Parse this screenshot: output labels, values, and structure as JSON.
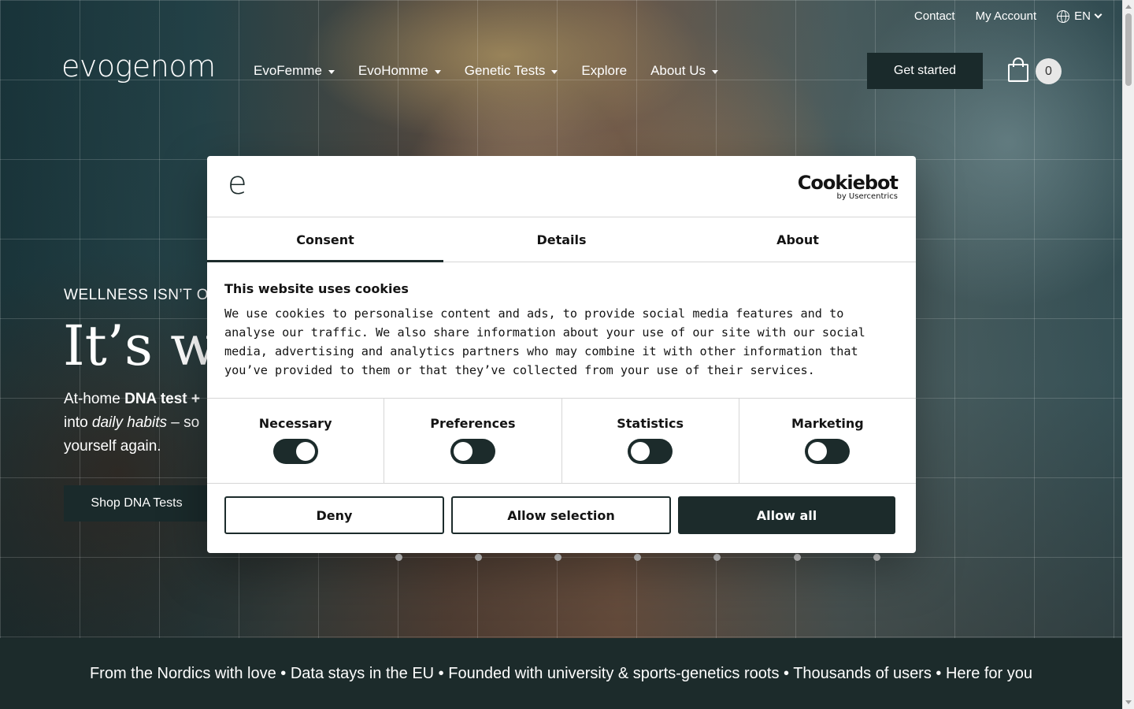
{
  "header": {
    "utility": {
      "contact": "Contact",
      "account": "My Account",
      "language": "EN"
    },
    "logo": "evogenom",
    "nav": [
      "EvoFemme",
      "EvoHomme",
      "Genetic Tests",
      "Explore",
      "About Us"
    ],
    "cta": "Get started",
    "cart_count": "0"
  },
  "hero": {
    "eyebrow": "WELLNESS ISN’T O",
    "headline": "It’s wri",
    "lead": {
      "part1": "At-home ",
      "bold": "DNA test +",
      "line2a": "into ",
      "italic": "daily habits",
      "line2b": " – so",
      "line3": "yourself again."
    },
    "shop_button": "Shop DNA Tests"
  },
  "band_text": "From the Nordics with love • Data stays in the EU • Founded with university & sports-genetics roots • Thousands of users • Here for you",
  "dialog": {
    "logo": "e",
    "brand": "Cookiebot",
    "brand_sub": "by Usercentrics",
    "tabs": [
      "Consent",
      "Details",
      "About"
    ],
    "title": "This website uses cookies",
    "body": "We use cookies to personalise content and ads, to provide social media features and to analyse our traffic. We also share information about your use of our site with our social media, advertising and analytics partners who may combine it with other information that you’ve provided to them or that they’ve collected from your use of their services.",
    "toggles": [
      {
        "label": "Necessary",
        "state": "on"
      },
      {
        "label": "Preferences",
        "state": "off"
      },
      {
        "label": "Statistics",
        "state": "off"
      },
      {
        "label": "Marketing",
        "state": "off"
      }
    ],
    "buttons": {
      "deny": "Deny",
      "selection": "Allow selection",
      "all": "Allow all"
    }
  },
  "colors": {
    "dark": "#1c2b2b",
    "white": "#ffffff",
    "border": "#d6d6d6"
  }
}
